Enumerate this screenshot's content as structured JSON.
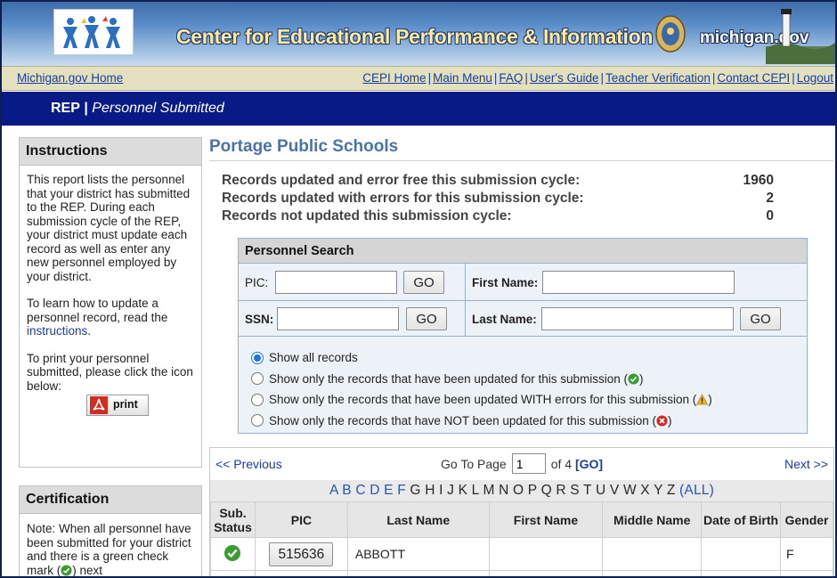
{
  "header": {
    "site_title": "Center for Educational Performance & Information",
    "michigan_brand": "michigan.gov"
  },
  "nav": {
    "home_link": "Michigan.gov Home",
    "links": [
      "CEPI Home",
      "Main Menu",
      "FAQ",
      "User's Guide",
      "Teacher Verification",
      "Contact CEPI",
      "Logout"
    ],
    "separator": "|"
  },
  "rep_bar": {
    "app": "REP",
    "separator": "|",
    "page": "Personnel Submitted"
  },
  "instructions": {
    "heading": "Instructions",
    "para1": "This report lists the personnel that your district has submitted to the REP. During each submission cycle of the REP, your district must update each record as well as enter any new personnel employed by your district.",
    "para2_prefix": "To learn how to update a personnel record, read the",
    "para2_link": "instructions",
    "para2_suffix": ".",
    "para3": "To print your personnel submitted, please click the icon below:",
    "print_label": "print"
  },
  "certification": {
    "heading": "Certification",
    "note": "Note: When all personnel have been submitted for your district and there is a green check mark (",
    "note_suffix": ") next"
  },
  "main": {
    "school_name": "Portage Public Schools",
    "stats": [
      {
        "label": "Records updated and error free this submission cycle:",
        "value": "1960"
      },
      {
        "label": "Records updated with errors for this submission cycle:",
        "value": "2"
      },
      {
        "label": "Records not updated this submission cycle:",
        "value": "0"
      }
    ]
  },
  "search": {
    "heading": "Personnel Search",
    "pic_label": "PIC:",
    "ssn_label": "SSN:",
    "first_name_label": "First Name:",
    "last_name_label": "Last Name:",
    "go_label": "GO",
    "pic_value": "",
    "ssn_value": "",
    "first_name_value": "",
    "last_name_value": "",
    "filters": [
      {
        "label": "Show all records",
        "icon": "",
        "selected": true
      },
      {
        "label": "Show only the records that have been updated for this submission (",
        "icon": "green-check-icon",
        "selected": false
      },
      {
        "label": "Show only the records that have been updated WITH errors for this submission (",
        "icon": "warning-icon",
        "selected": false
      },
      {
        "label": "Show only the records that have NOT been updated for this submission (",
        "icon": "red-x-icon",
        "selected": false
      }
    ],
    "filter_close": ")"
  },
  "results": {
    "previous": "<< Previous",
    "go_to_page": "Go To Page",
    "page_value": "1",
    "of_pages": "of 4",
    "go_link": "[GO]",
    "next": "Next >>",
    "letters_linked": [
      "A",
      "B",
      "C",
      "D",
      "E",
      "F"
    ],
    "letters_plain": [
      "G",
      "H",
      "I",
      "J",
      "K",
      "L",
      "M",
      "N",
      "O",
      "P",
      "Q",
      "R",
      "S",
      "T",
      "U",
      "V",
      "W",
      "X",
      "Y",
      "Z"
    ],
    "all_link": "(ALL)",
    "columns": [
      "Sub. Status",
      "PIC",
      "Last Name",
      "First Name",
      "Middle Name",
      "Date of Birth",
      "Gender"
    ],
    "rows": [
      {
        "status_icon": "green-check-icon",
        "pic": "515636",
        "last_name": "ABBOTT",
        "first_name": "",
        "middle_name": "",
        "dob": "",
        "gender": "F"
      }
    ]
  },
  "colors": {
    "banner_blue": "#3e6da8",
    "rep_bar": "#081a85",
    "nav_bar": "#e3e0bf",
    "title_blue": "#4a74a6",
    "link_blue": "#1a3e9e"
  }
}
